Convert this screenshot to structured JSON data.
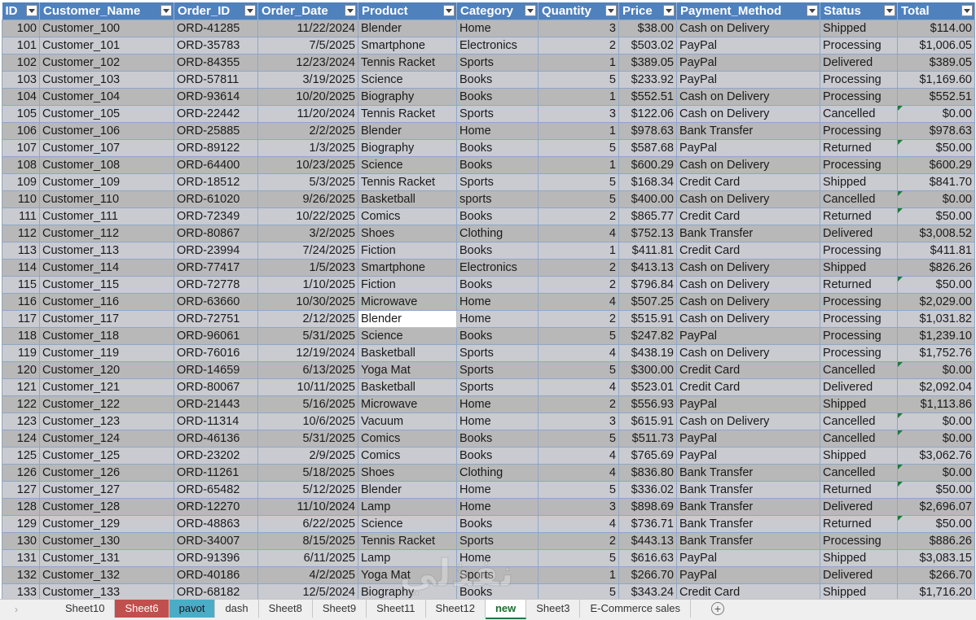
{
  "headers": [
    "ID",
    "Customer_Name",
    "Order_ID",
    "Order_Date",
    "Product",
    "Category",
    "Quantity",
    "Price",
    "Payment_Method",
    "Status",
    "Total"
  ],
  "rows": [
    [
      "100",
      "Customer_100",
      "ORD-41285",
      "11/22/2024",
      "Blender",
      "Home",
      "3",
      "$38.00",
      "Cash on Delivery",
      "Shipped",
      "$114.00"
    ],
    [
      "101",
      "Customer_101",
      "ORD-35783",
      "7/5/2025",
      "Smartphone",
      "Electronics",
      "2",
      "$503.02",
      "PayPal",
      "Processing",
      "$1,006.05"
    ],
    [
      "102",
      "Customer_102",
      "ORD-84355",
      "12/23/2024",
      "Tennis Racket",
      "Sports",
      "1",
      "$389.05",
      "PayPal",
      "Delivered",
      "$389.05"
    ],
    [
      "103",
      "Customer_103",
      "ORD-57811",
      "3/19/2025",
      "Science",
      "Books",
      "5",
      "$233.92",
      "PayPal",
      "Processing",
      "$1,169.60"
    ],
    [
      "104",
      "Customer_104",
      "ORD-93614",
      "10/20/2025",
      "Biography",
      "Books",
      "1",
      "$552.51",
      "Cash on Delivery",
      "Processing",
      "$552.51"
    ],
    [
      "105",
      "Customer_105",
      "ORD-22442",
      "11/20/2024",
      "Tennis Racket",
      "Sports",
      "3",
      "$122.06",
      "Cash on Delivery",
      "Cancelled",
      "$0.00"
    ],
    [
      "106",
      "Customer_106",
      "ORD-25885",
      "2/2/2025",
      "Blender",
      "Home",
      "1",
      "$978.63",
      "Bank Transfer",
      "Processing",
      "$978.63"
    ],
    [
      "107",
      "Customer_107",
      "ORD-89122",
      "1/3/2025",
      "Biography",
      "Books",
      "5",
      "$587.68",
      "PayPal",
      "Returned",
      "$50.00"
    ],
    [
      "108",
      "Customer_108",
      "ORD-64400",
      "10/23/2025",
      "Science",
      "Books",
      "1",
      "$600.29",
      "Cash on Delivery",
      "Processing",
      "$600.29"
    ],
    [
      "109",
      "Customer_109",
      "ORD-18512",
      "5/3/2025",
      "Tennis Racket",
      "Sports",
      "5",
      "$168.34",
      "Credit Card",
      "Shipped",
      "$841.70"
    ],
    [
      "110",
      "Customer_110",
      "ORD-61020",
      "9/26/2025",
      "Basketball",
      "sports",
      "5",
      "$400.00",
      "Cash on Delivery",
      "Cancelled",
      "$0.00"
    ],
    [
      "111",
      "Customer_111",
      "ORD-72349",
      "10/22/2025",
      "Comics",
      "Books",
      "2",
      "$865.77",
      "Credit Card",
      "Returned",
      "$50.00"
    ],
    [
      "112",
      "Customer_112",
      "ORD-80867",
      "3/2/2025",
      "Shoes",
      "Clothing",
      "4",
      "$752.13",
      "Bank Transfer",
      "Delivered",
      "$3,008.52"
    ],
    [
      "113",
      "Customer_113",
      "ORD-23994",
      "7/24/2025",
      "Fiction",
      "Books",
      "1",
      "$411.81",
      "Credit Card",
      "Processing",
      "$411.81"
    ],
    [
      "114",
      "Customer_114",
      "ORD-77417",
      "1/5/2023",
      "Smartphone",
      "Electronics",
      "2",
      "$413.13",
      "Cash on Delivery",
      "Shipped",
      "$826.26"
    ],
    [
      "115",
      "Customer_115",
      "ORD-72778",
      "1/10/2025",
      "Fiction",
      "Books",
      "2",
      "$796.84",
      "Cash on Delivery",
      "Returned",
      "$50.00"
    ],
    [
      "116",
      "Customer_116",
      "ORD-63660",
      "10/30/2025",
      "Microwave",
      "Home",
      "4",
      "$507.25",
      "Cash on Delivery",
      "Processing",
      "$2,029.00"
    ],
    [
      "117",
      "Customer_117",
      "ORD-72751",
      "2/12/2025",
      "Blender",
      "Home",
      "2",
      "$515.91",
      "Cash on Delivery",
      "Processing",
      "$1,031.82"
    ],
    [
      "118",
      "Customer_118",
      "ORD-96061",
      "5/31/2025",
      "Science",
      "Books",
      "5",
      "$247.82",
      "PayPal",
      "Processing",
      "$1,239.10"
    ],
    [
      "119",
      "Customer_119",
      "ORD-76016",
      "12/19/2024",
      "Basketball",
      "Sports",
      "4",
      "$438.19",
      "Cash on Delivery",
      "Processing",
      "$1,752.76"
    ],
    [
      "120",
      "Customer_120",
      "ORD-14659",
      "6/13/2025",
      "Yoga Mat",
      "Sports",
      "5",
      "$300.00",
      "Credit Card",
      "Cancelled",
      "$0.00"
    ],
    [
      "121",
      "Customer_121",
      "ORD-80067",
      "10/11/2025",
      "Basketball",
      "Sports",
      "4",
      "$523.01",
      "Credit Card",
      "Delivered",
      "$2,092.04"
    ],
    [
      "122",
      "Customer_122",
      "ORD-21443",
      "5/16/2025",
      "Microwave",
      "Home",
      "2",
      "$556.93",
      "PayPal",
      "Shipped",
      "$1,113.86"
    ],
    [
      "123",
      "Customer_123",
      "ORD-11314",
      "10/6/2025",
      "Vacuum",
      "Home",
      "3",
      "$615.91",
      "Cash on Delivery",
      "Cancelled",
      "$0.00"
    ],
    [
      "124",
      "Customer_124",
      "ORD-46136",
      "5/31/2025",
      "Comics",
      "Books",
      "5",
      "$511.73",
      "PayPal",
      "Cancelled",
      "$0.00"
    ],
    [
      "125",
      "Customer_125",
      "ORD-23202",
      "2/9/2025",
      "Comics",
      "Books",
      "4",
      "$765.69",
      "PayPal",
      "Shipped",
      "$3,062.76"
    ],
    [
      "126",
      "Customer_126",
      "ORD-11261",
      "5/18/2025",
      "Shoes",
      "Clothing",
      "4",
      "$836.80",
      "Bank Transfer",
      "Cancelled",
      "$0.00"
    ],
    [
      "127",
      "Customer_127",
      "ORD-65482",
      "5/12/2025",
      "Blender",
      "Home",
      "5",
      "$336.02",
      "Bank Transfer",
      "Returned",
      "$50.00"
    ],
    [
      "128",
      "Customer_128",
      "ORD-12270",
      "11/10/2024",
      "Lamp",
      "Home",
      "3",
      "$898.69",
      "Bank Transfer",
      "Delivered",
      "$2,696.07"
    ],
    [
      "129",
      "Customer_129",
      "ORD-48863",
      "6/22/2025",
      "Science",
      "Books",
      "4",
      "$736.71",
      "Bank Transfer",
      "Returned",
      "$50.00"
    ],
    [
      "130",
      "Customer_130",
      "ORD-34007",
      "8/15/2025",
      "Tennis Racket",
      "Sports",
      "2",
      "$443.13",
      "Bank Transfer",
      "Processing",
      "$886.26"
    ],
    [
      "131",
      "Customer_131",
      "ORD-91396",
      "6/11/2025",
      "Lamp",
      "Home",
      "5",
      "$616.63",
      "PayPal",
      "Shipped",
      "$3,083.15"
    ],
    [
      "132",
      "Customer_132",
      "ORD-40186",
      "4/2/2025",
      "Yoga Mat",
      "Sports",
      "1",
      "$266.70",
      "PayPal",
      "Delivered",
      "$266.70"
    ],
    [
      "133",
      "Customer_133",
      "ORD-68182",
      "12/5/2024",
      "Biography",
      "Books",
      "5",
      "$343.24",
      "Credit Card",
      "Shipped",
      "$1,716.20"
    ]
  ],
  "selected_cell": {
    "row": 17,
    "col": 4
  },
  "error_marker_rows": [
    5,
    7,
    10,
    11,
    15,
    20,
    23,
    24,
    26,
    27,
    29
  ],
  "sheet_tabs": [
    {
      "label": "Sheet10",
      "style": "plain"
    },
    {
      "label": "Sheet6",
      "style": "red"
    },
    {
      "label": "pavot",
      "style": "teal"
    },
    {
      "label": "dash",
      "style": "plain"
    },
    {
      "label": "Sheet8",
      "style": "plain"
    },
    {
      "label": "Sheet9",
      "style": "plain"
    },
    {
      "label": "Sheet11",
      "style": "plain"
    },
    {
      "label": "Sheet12",
      "style": "plain"
    },
    {
      "label": "new",
      "style": "active"
    },
    {
      "label": "Sheet3",
      "style": "plain"
    },
    {
      "label": "E-Commerce sales",
      "style": "plain"
    }
  ],
  "add_sheet_label": "+",
  "nav_arrow": "›",
  "colors": {
    "header_bg": "#4f81bd",
    "row_odd": "#b8b8b8",
    "row_even": "#c9cbd1",
    "tab_red": "#c0504d",
    "tab_teal": "#4bacc6",
    "active_tab_text": "#1d6f2f"
  },
  "icons": {
    "filter": "filter-dropdown-icon",
    "add": "add-sheet-icon",
    "nav": "tab-scroll-arrow-icon"
  }
}
